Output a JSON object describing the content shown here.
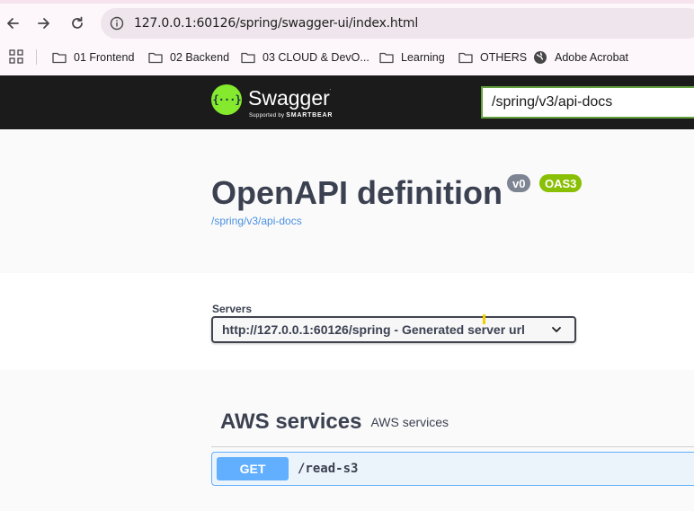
{
  "browser": {
    "url": "127.0.0.1:60126/spring/swagger-ui/index.html",
    "bookmarks": [
      {
        "label": "01 Frontend",
        "icon": "folder-icon"
      },
      {
        "label": "02 Backend",
        "icon": "folder-icon"
      },
      {
        "label": "03 CLOUD & DevO...",
        "icon": "folder-icon"
      },
      {
        "label": "Learning",
        "icon": "folder-icon"
      },
      {
        "label": "OTHERS",
        "icon": "folder-icon"
      },
      {
        "label": "Adobe Acrobat",
        "icon": "globe-icon"
      }
    ]
  },
  "swagger": {
    "brand": "Swagger",
    "tagline_prefix": "Supported by",
    "tagline_brand": "SMARTBEAR",
    "spec_url_input": "/spring/v3/api-docs",
    "logo_glyph": "{···}"
  },
  "info": {
    "title": "OpenAPI definition",
    "version": "v0",
    "spec_badge": "OAS3",
    "spec_link": "/spring/v3/api-docs"
  },
  "servers": {
    "label": "Servers",
    "selected": "http://127.0.0.1:60126/spring - Generated server url"
  },
  "tags": [
    {
      "name": "AWS services",
      "description": "AWS services",
      "operations": [
        {
          "method": "GET",
          "path": "/read-s3"
        }
      ]
    }
  ],
  "colors": {
    "swagger_green": "#85ea2d",
    "get_blue": "#61affe",
    "oas3_green": "#89bf04",
    "version_gray": "#7d8492",
    "topbar": "#1b1b1b"
  }
}
